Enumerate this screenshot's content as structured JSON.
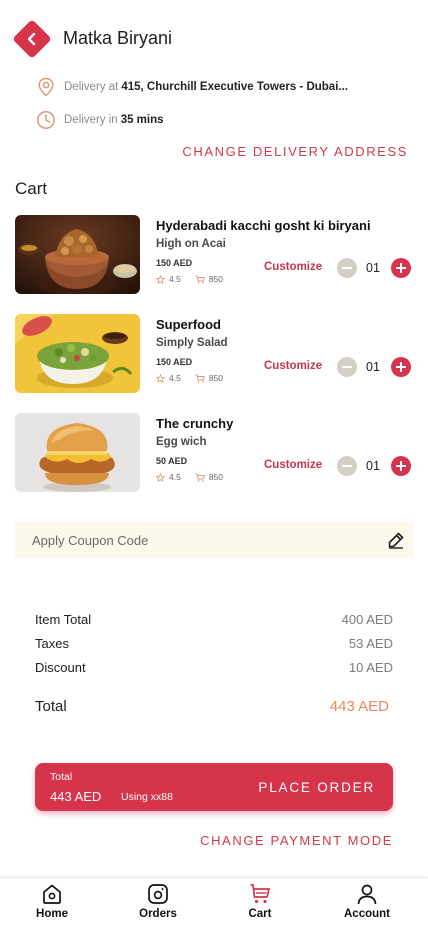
{
  "header": {
    "back_icon": "chevron-left-icon",
    "title": "Matka Biryani"
  },
  "delivery": {
    "address_prefix": "Delivery at",
    "address": "415, Churchill Executive Towers - Dubai...",
    "time_prefix": "Delivery in",
    "time": "35 mins",
    "change_address_label": "CHANGE DELIVERY ADDRESS"
  },
  "cart": {
    "heading": "Cart",
    "customize_label": "Customize",
    "items": [
      {
        "name": "Hyderabadi kacchi gosht ki biryani",
        "restaurant": "High on Acai",
        "price": "150 AED",
        "rating": "4.5",
        "orders": "850",
        "quantity": "01"
      },
      {
        "name": "Superfood",
        "restaurant": "Simply Salad",
        "price": "150 AED",
        "rating": "4.5",
        "orders": "850",
        "quantity": "01"
      },
      {
        "name": "The crunchy",
        "restaurant": "Egg wich",
        "price": "50 AED",
        "rating": "4.5",
        "orders": "850",
        "quantity": "01"
      }
    ]
  },
  "coupon": {
    "placeholder": "Apply Coupon Code"
  },
  "bill": {
    "item_total_label": "Item Total",
    "item_total": "400 AED",
    "taxes_label": "Taxes",
    "taxes": "53 AED",
    "discount_label": "Discount",
    "discount": "10 AED",
    "total_label": "Total",
    "total": "443 AED"
  },
  "order_bar": {
    "total_label": "Total",
    "total_amount": "443 AED",
    "payment_using": "Using xx88",
    "place_order_label": "PLACE ORDER"
  },
  "change_payment_label": "CHANGE PAYMENT MODE",
  "nav": [
    {
      "label": "Home",
      "icon": "home-icon"
    },
    {
      "label": "Orders",
      "icon": "orders-icon"
    },
    {
      "label": "Cart",
      "icon": "cart-icon",
      "active": true
    },
    {
      "label": "Account",
      "icon": "account-icon"
    }
  ],
  "colors": {
    "accent": "#d6344a",
    "coupon_bg": "#fdf8ec",
    "total_value": "#e08c62",
    "address_icon": "#d99a7a"
  }
}
